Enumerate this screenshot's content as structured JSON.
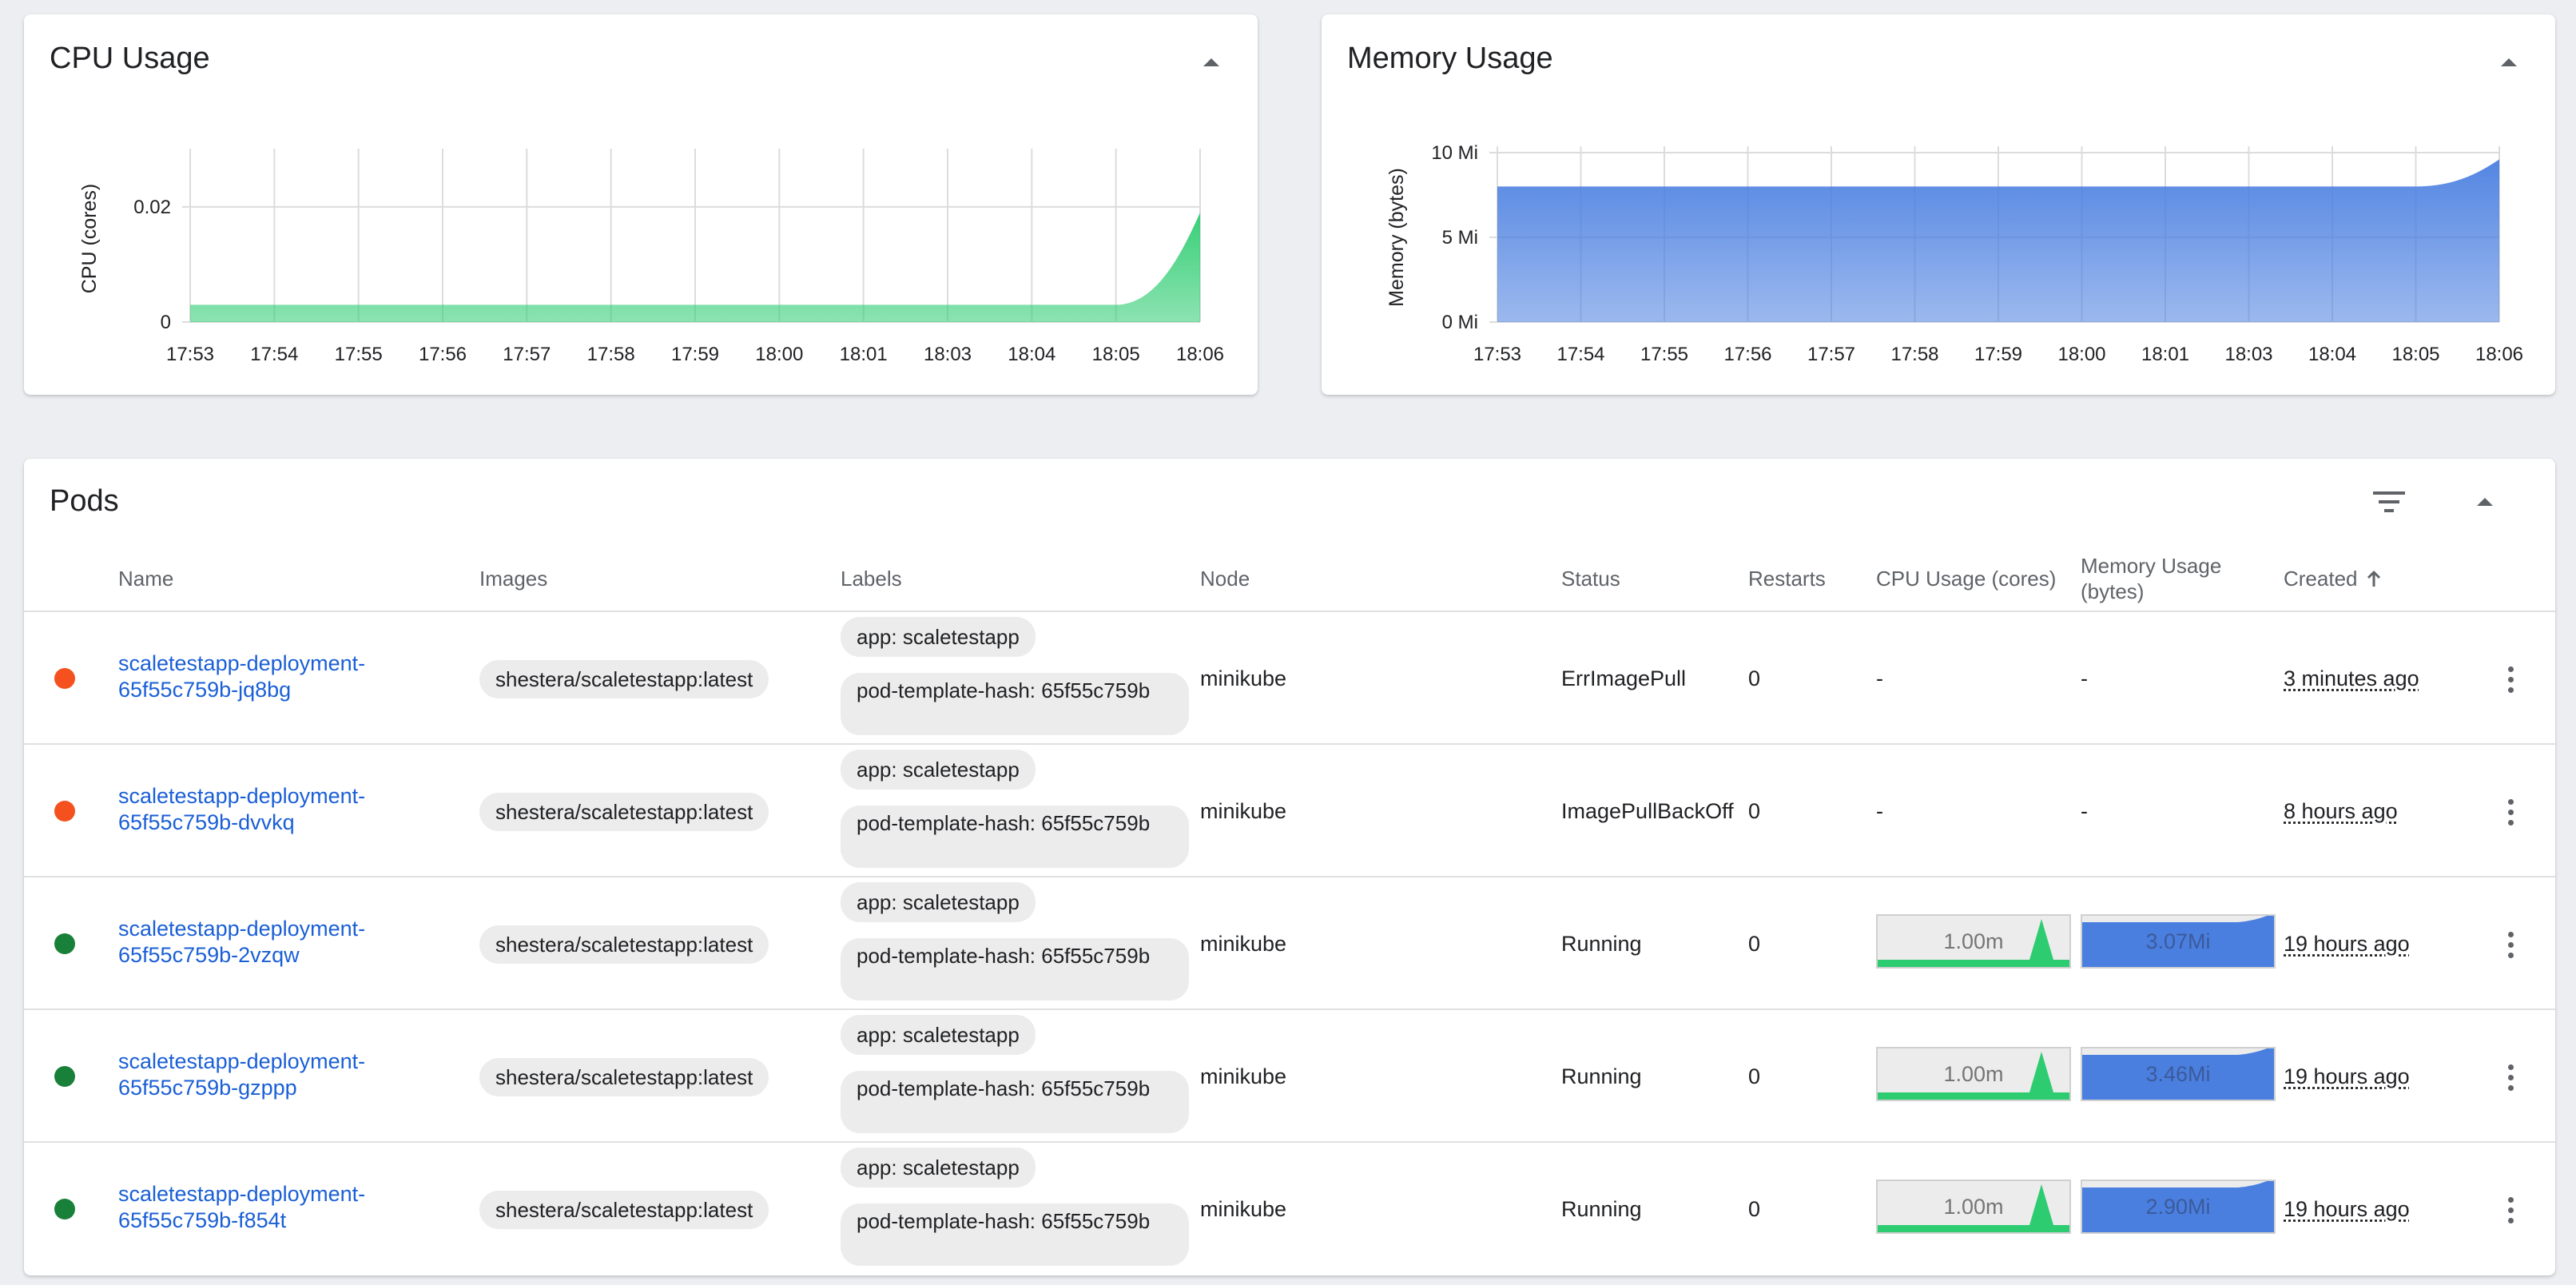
{
  "colors": {
    "cpu_fill": "#2ecc71",
    "memory_fill": "#4a7fe0",
    "link": "#1a5fd6",
    "status_error": "#f4511e",
    "status_ok": "#188038"
  },
  "cpu_card": {
    "title": "CPU Usage",
    "collapse_icon": "caret-up-icon"
  },
  "memory_card": {
    "title": "Memory Usage",
    "collapse_icon": "caret-up-icon"
  },
  "chart_data": [
    {
      "type": "area",
      "title": "CPU Usage",
      "ylabel": "CPU (cores)",
      "xlabel": "",
      "x": [
        "17:53",
        "17:54",
        "17:55",
        "17:56",
        "17:57",
        "17:58",
        "17:59",
        "18:00",
        "18:01",
        "18:03",
        "18:04",
        "18:05",
        "18:06"
      ],
      "yticks": [
        "0",
        "0.02"
      ],
      "ylim": [
        0,
        0.029
      ],
      "grid": true,
      "series": [
        {
          "values": [
            0.003,
            0.003,
            0.003,
            0.003,
            0.003,
            0.003,
            0.003,
            0.003,
            0.003,
            0.003,
            0.003,
            0.003,
            0.019
          ]
        }
      ]
    },
    {
      "type": "area",
      "title": "Memory Usage",
      "ylabel": "Memory (bytes)",
      "xlabel": "",
      "x": [
        "17:53",
        "17:54",
        "17:55",
        "17:56",
        "17:57",
        "17:58",
        "17:59",
        "18:00",
        "18:01",
        "18:03",
        "18:04",
        "18:05",
        "18:06"
      ],
      "yticks": [
        "0 Mi",
        "5 Mi",
        "10 Mi"
      ],
      "ylim": [
        0,
        10
      ],
      "grid": true,
      "series": [
        {
          "values": [
            8.0,
            8.0,
            8.0,
            8.0,
            8.0,
            8.0,
            8.0,
            8.0,
            8.0,
            8.0,
            8.0,
            8.0,
            9.6
          ]
        }
      ]
    }
  ],
  "pods": {
    "title": "Pods",
    "filter_icon": "filter-icon",
    "collapse_icon": "caret-up-icon",
    "columns": {
      "name": "Name",
      "images": "Images",
      "labels": "Labels",
      "node": "Node",
      "status": "Status",
      "restarts": "Restarts",
      "cpu": "CPU Usage (cores)",
      "memory_line1": "Memory Usage",
      "memory_line2": "(bytes)",
      "created": "Created",
      "created_sort_icon": "arrow-up-icon"
    },
    "rows": [
      {
        "name_line1": "scaletestapp-deployment-",
        "name_line2": "65f55c759b-jq8bg",
        "image": "shestera/scaletestapp:latest",
        "label_app": "app: scaletestapp",
        "label_hash": "pod-template-hash: 65f55c759b",
        "node": "minikube",
        "status": "ErrImagePull",
        "status_level": "error",
        "restarts": "0",
        "cpu": "-",
        "memory": "-",
        "created": "3 minutes ago"
      },
      {
        "name_line1": "scaletestapp-deployment-",
        "name_line2": "65f55c759b-dvvkq",
        "image": "shestera/scaletestapp:latest",
        "label_app": "app: scaletestapp",
        "label_hash": "pod-template-hash: 65f55c759b",
        "node": "minikube",
        "status": "ImagePullBackOff",
        "status_level": "error",
        "restarts": "0",
        "cpu": "-",
        "memory": "-",
        "created": "8 hours ago"
      },
      {
        "name_line1": "scaletestapp-deployment-",
        "name_line2": "65f55c759b-2vzqw",
        "image": "shestera/scaletestapp:latest",
        "label_app": "app: scaletestapp",
        "label_hash": "pod-template-hash: 65f55c759b",
        "node": "minikube",
        "status": "Running",
        "status_level": "ok",
        "restarts": "0",
        "cpu": "1.00m",
        "memory": "3.07Mi",
        "created": "19 hours ago"
      },
      {
        "name_line1": "scaletestapp-deployment-",
        "name_line2": "65f55c759b-gzppp",
        "image": "shestera/scaletestapp:latest",
        "label_app": "app: scaletestapp",
        "label_hash": "pod-template-hash: 65f55c759b",
        "node": "minikube",
        "status": "Running",
        "status_level": "ok",
        "restarts": "0",
        "cpu": "1.00m",
        "memory": "3.46Mi",
        "created": "19 hours ago"
      },
      {
        "name_line1": "scaletestapp-deployment-",
        "name_line2": "65f55c759b-f854t",
        "image": "shestera/scaletestapp:latest",
        "label_app": "app: scaletestapp",
        "label_hash": "pod-template-hash: 65f55c759b",
        "node": "minikube",
        "status": "Running",
        "status_level": "ok",
        "restarts": "0",
        "cpu": "1.00m",
        "memory": "2.90Mi",
        "created": "19 hours ago"
      }
    ]
  }
}
